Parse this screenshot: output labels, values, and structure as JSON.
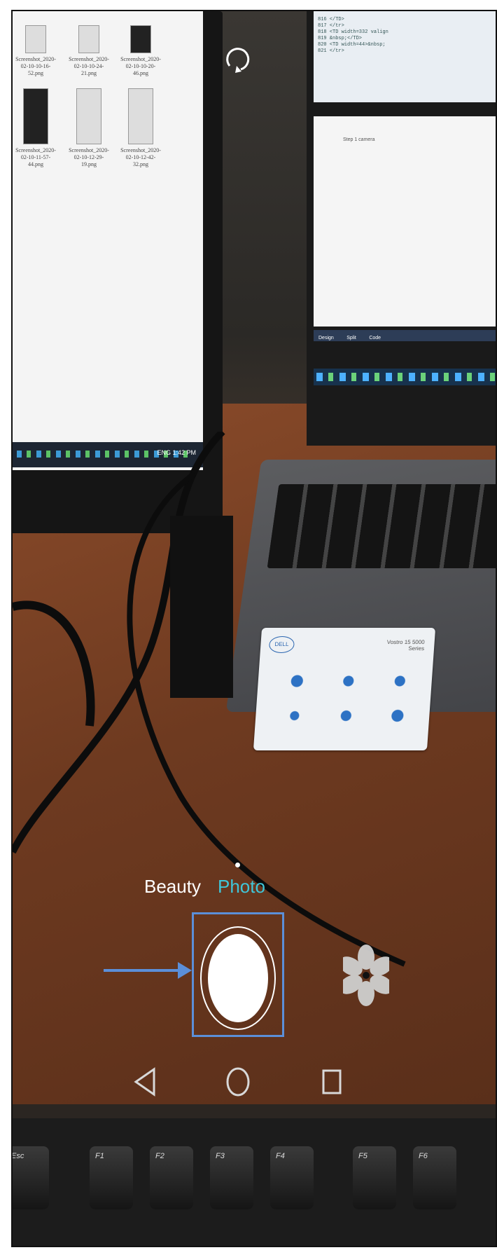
{
  "camera": {
    "modes": [
      {
        "label": "Beauty"
      },
      {
        "label": "Photo"
      }
    ],
    "active_mode": "Photo",
    "accent_color": "#3fc6d9",
    "highlight_color": "#5b8fd9",
    "icons": {
      "rotate": "rotate-camera-icon",
      "filter": "flower-filter-icon",
      "shutter": "shutter-button",
      "pointer": "arrow-pointer-icon"
    }
  },
  "navigation": {
    "icons": [
      "back-triangle-icon",
      "home-circle-icon",
      "recents-square-icon"
    ]
  },
  "scene": {
    "monitor_thumbnails": [
      {
        "caption": "Screenshot_2020-02-10-10-16-52.png"
      },
      {
        "caption": "Screenshot_2020-02-10-10-24-21.png"
      },
      {
        "caption": "Screenshot_2020-02-10-10-20-46.png"
      },
      {
        "caption": "Screenshot_2020-02-10-11-57-44.png"
      },
      {
        "caption": "Screenshot_2020-02-10-12-29-19.png"
      },
      {
        "caption": "Screenshot_2020-02-10-12-42-32.png"
      }
    ],
    "monitor_taskbar": {
      "time": "1:42 PM",
      "lang": "ENG"
    },
    "laptop_code_lines": [
      "816        </TD>",
      "817      </tr>",
      "818      <TD width=332 valign",
      "819        &nbsp;</TD>",
      "820      <TD width=44>&nbsp;",
      "821      </tr>"
    ],
    "laptop_design_text": "Step 1 camera",
    "editor_tabs": [
      "Design",
      "Split",
      "Code"
    ],
    "sticker": {
      "brand": "DELL",
      "model": "Vostro 15 5000 Series"
    },
    "bottom_keys": [
      "Esc",
      "F1",
      "F2",
      "F3",
      "F4",
      "F5",
      "F6"
    ]
  }
}
